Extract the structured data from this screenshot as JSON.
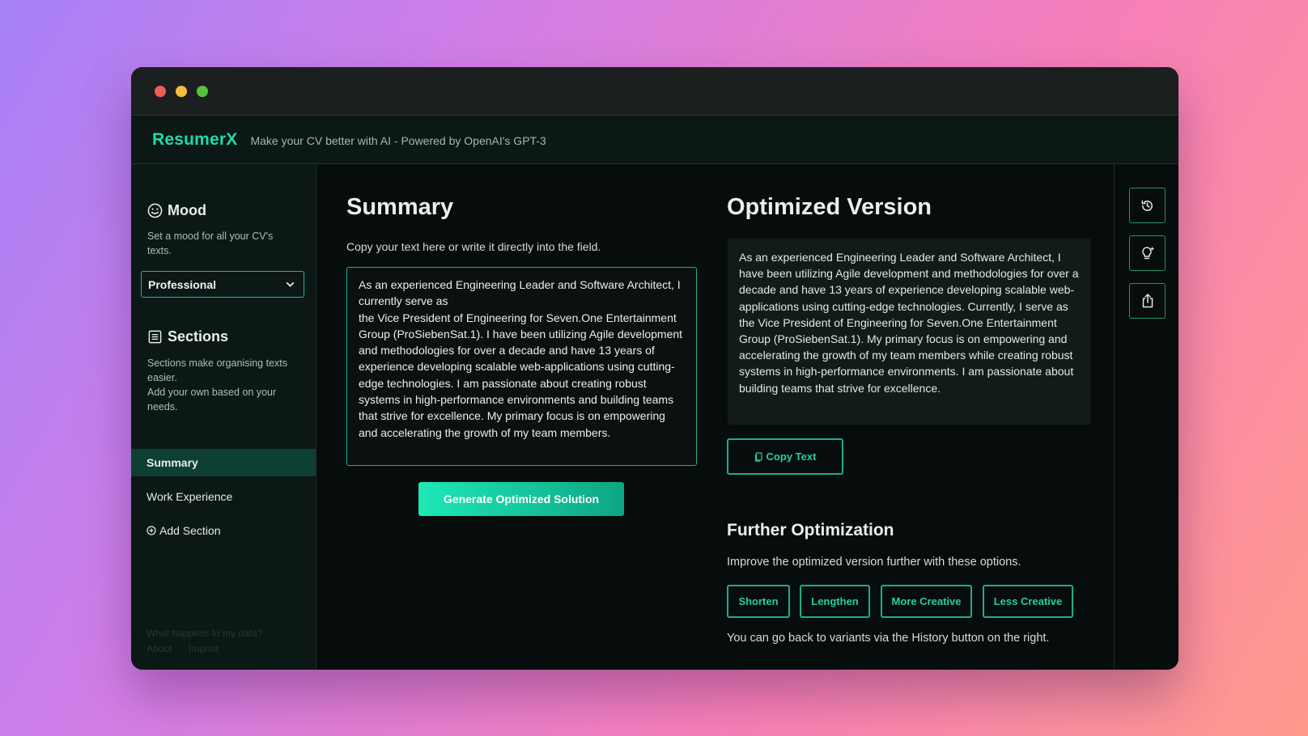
{
  "window_controls": {
    "close_color": "#ec5f56",
    "minimize_color": "#f4bd3f",
    "zoom_color": "#56c23f"
  },
  "app": {
    "brand": "ResumerX",
    "tagline": "Make your CV better with AI - Powered by OpenAI's GPT-3"
  },
  "sidebar": {
    "mood": {
      "title": "Mood",
      "description": "Set a mood for all your CV's texts.",
      "selected": "Professional"
    },
    "sections": {
      "title": "Sections",
      "description": "Sections make organising texts easier.\nAdd your own based on your needs.",
      "items": [
        {
          "label": "Summary",
          "active": true
        },
        {
          "label": "Work Experience",
          "active": false
        }
      ],
      "add_label": "Add Section"
    },
    "footer": {
      "privacy": "What happens to my data?",
      "about": "About",
      "imprint": "Imprint"
    }
  },
  "summary": {
    "title": "Summary",
    "instruction": "Copy your text here or write it directly into the field.",
    "text": "As an experienced Engineering Leader and Software Architect, I currently serve as\nthe Vice President of Engineering for Seven.One Entertainment Group (ProSiebenSat.1). I have been utilizing Agile development and methodologies for over a decade and have 13 years of experience developing scalable web-applications using cutting-edge technologies. I am passionate about creating robust systems in high-performance environments and building teams that strive for excellence. My primary focus is on empowering and accelerating the growth of my team members.",
    "generate_label": "Generate Optimized Solution"
  },
  "optimized": {
    "title": "Optimized Version",
    "text": "As an experienced Engineering Leader and Software Architect, I have been utilizing Agile development and methodologies for over a decade and have 13 years of experience developing scalable web-applications using cutting-edge technologies. Currently, I serve as the Vice President of Engineering for Seven.One Entertainment Group (ProSiebenSat.1). My primary focus is on empowering and accelerating the growth of my team members while creating robust systems in high-performance environments. I am passionate about building teams that strive for excellence.",
    "copy_label": "Copy Text"
  },
  "further": {
    "title": "Further Optimization",
    "description": "Improve the optimized version further with these options.",
    "options": [
      "Shorten",
      "Lengthen",
      "More Creative",
      "Less Creative"
    ],
    "note": "You can go back to variants via the History button on the right."
  },
  "colors": {
    "accent": "#1fdbac",
    "button_gradient_start": "#1ee8b6",
    "button_gradient_end": "#0ea583"
  },
  "right_toolbar": {
    "icons": [
      "history-icon",
      "lightbulb-icon",
      "share-icon"
    ]
  }
}
